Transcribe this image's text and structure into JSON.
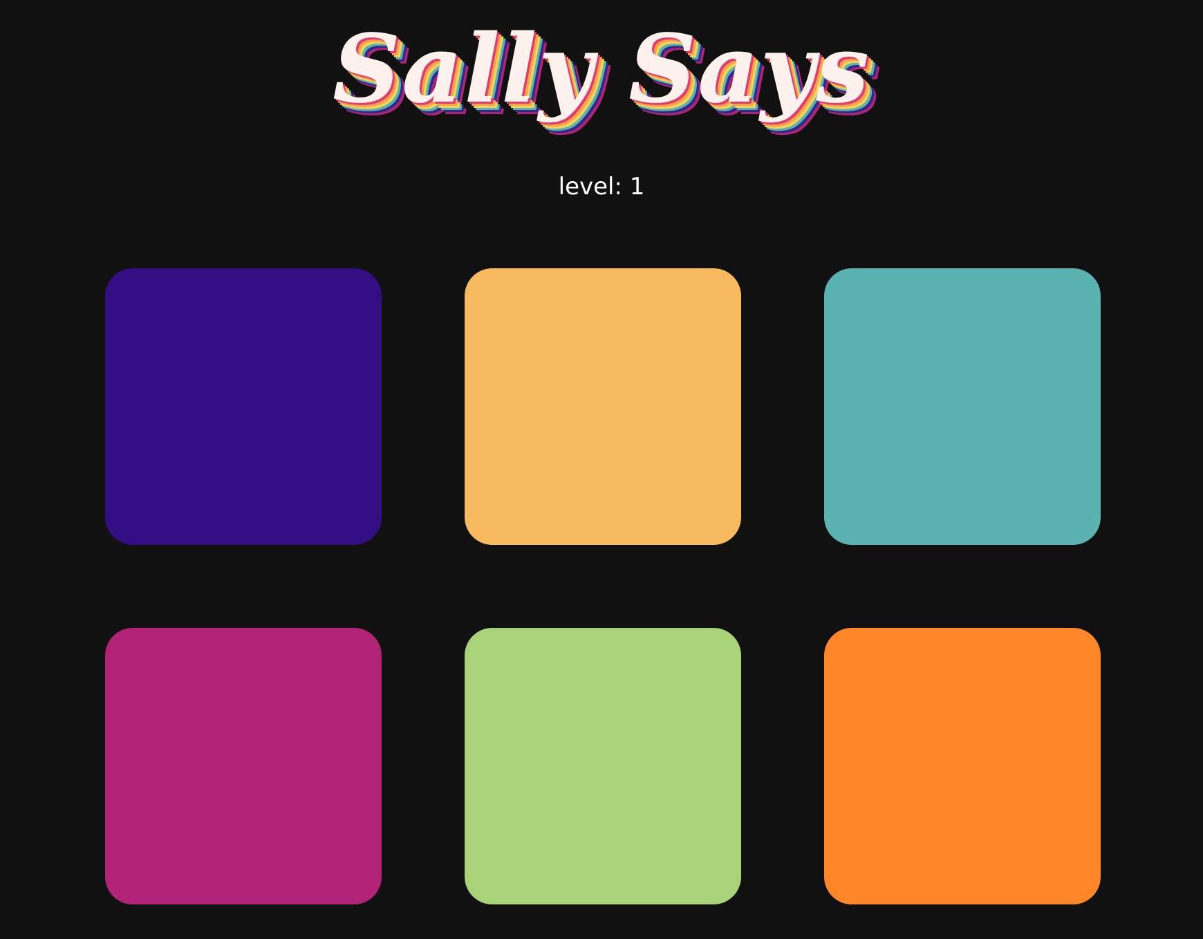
{
  "game": {
    "title": "Sally Says",
    "level_text": "level: 1",
    "level": 1
  },
  "colors": {
    "background": "#111111",
    "title_fill": "#fdf1ee",
    "title_shadow": [
      "#e23b6e",
      "#f6a34a",
      "#f3d35a",
      "#5ab3ae",
      "#2e2a8c",
      "#b02475"
    ]
  },
  "tiles": [
    {
      "name": "tile-purple",
      "color": "#330e82"
    },
    {
      "name": "tile-yellow",
      "color": "#f8ba5e"
    },
    {
      "name": "tile-teal",
      "color": "#5ab3b0"
    },
    {
      "name": "tile-magenta",
      "color": "#b12376"
    },
    {
      "name": "tile-green",
      "color": "#a8d378"
    },
    {
      "name": "tile-orange",
      "color": "#ff8727"
    }
  ]
}
